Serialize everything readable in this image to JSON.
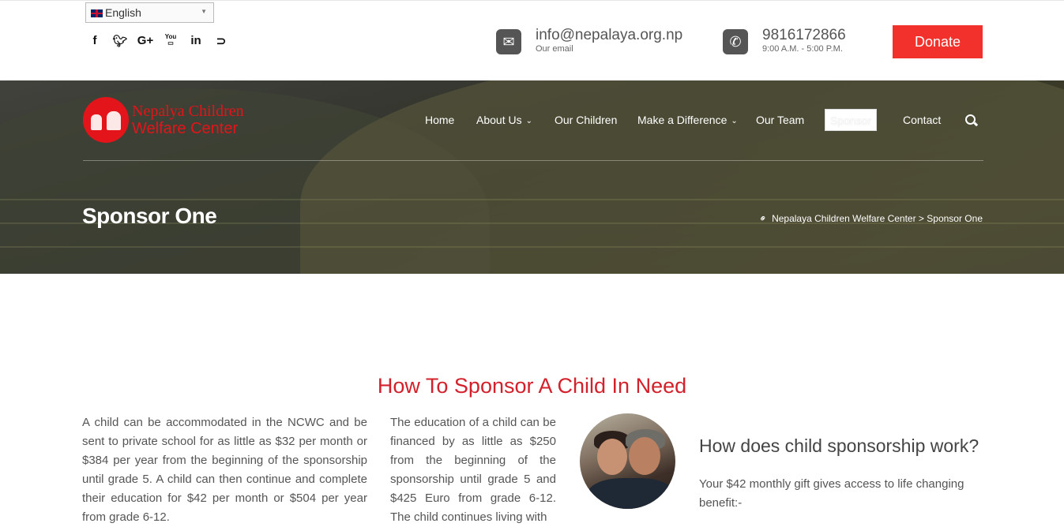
{
  "topbar": {
    "language": "English",
    "email": {
      "value": "info@nepalaya.org.np",
      "label": "Our email"
    },
    "phone": {
      "value": "9816172866",
      "hours": "9:00 A.M. - 5:00 P.M."
    },
    "donate_label": "Donate",
    "social": [
      "f",
      "🐦",
      "G+",
      "You Tube",
      "in",
      "rss"
    ]
  },
  "header": {
    "logo_line1": "Nepalya Children",
    "logo_line2": "Welfare Center",
    "nav": {
      "home": "Home",
      "about": "About Us",
      "children": "Our Children",
      "difference": "Make a Difference",
      "team": "Our Team",
      "sponsor": "Sponsor",
      "contact": "Contact"
    }
  },
  "hero": {
    "title": "Sponsor One",
    "breadcrumb": "Nepalaya Children Welfare Center > Sponsor One"
  },
  "main": {
    "title": "How To Sponsor A Child In Need",
    "col1": "A child can be accommodated in the NCWC and be sent to private school for as little as $32 per month or $384 per year from the beginning of the sponsorship until grade 5. A child can then continue and complete their education for $42 per month or $504 per year from grade 6-12.",
    "col2": "The education of a child can be financed by as little as $250 from the beginning of the sponsorship until grade 5 and $425 Euro from grade 6-12. The child continues living with",
    "side_title": "How does child sponsorship work?",
    "side_text": "Your $42 monthly gift gives access to life changing benefit:-"
  },
  "colors": {
    "accent": "#d3212b",
    "donate": "#f2312c",
    "logo": "#e3141a"
  }
}
